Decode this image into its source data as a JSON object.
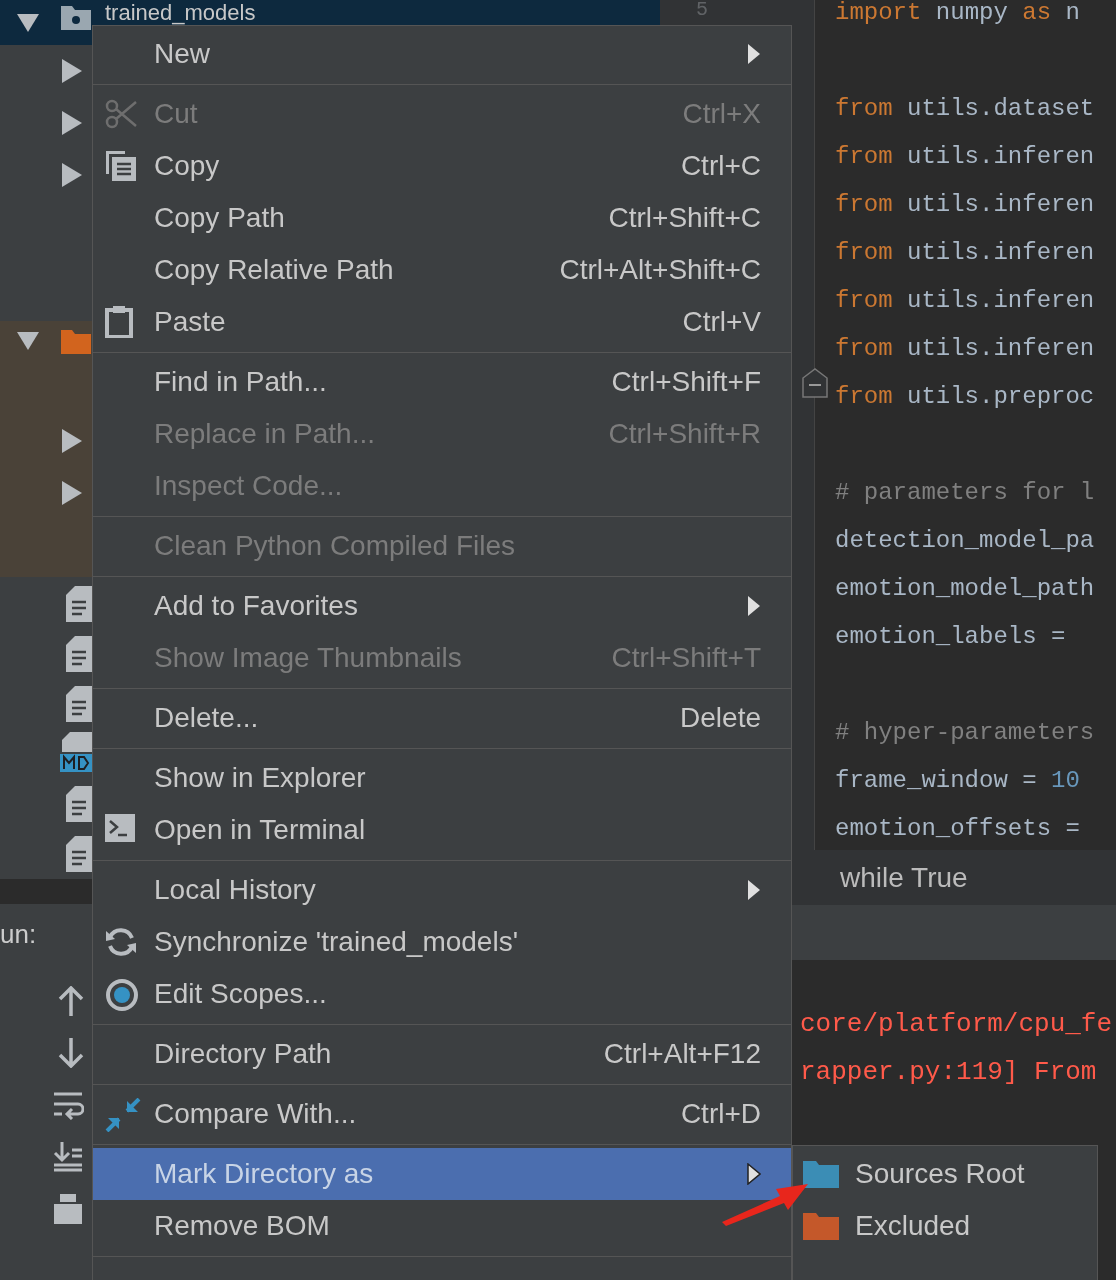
{
  "project_tree": {
    "root_label": "trained_models"
  },
  "gutter": {
    "line_number": "5"
  },
  "editor": {
    "lines": [
      {
        "kind": "code",
        "segments": [
          {
            "text": "import",
            "kind": "keyword"
          },
          {
            "text": " numpy ",
            "kind": "plain"
          },
          {
            "text": "as",
            "kind": "keyword"
          },
          {
            "text": " n",
            "kind": "plain"
          }
        ]
      },
      {
        "kind": "blank"
      },
      {
        "kind": "code",
        "segments": [
          {
            "text": "from",
            "kind": "keyword"
          },
          {
            "text": " utils.dataset",
            "kind": "plain"
          }
        ]
      },
      {
        "kind": "code",
        "segments": [
          {
            "text": "from",
            "kind": "keyword"
          },
          {
            "text": " utils.inferen",
            "kind": "plain"
          }
        ]
      },
      {
        "kind": "code",
        "segments": [
          {
            "text": "from",
            "kind": "keyword"
          },
          {
            "text": " utils.inferen",
            "kind": "plain"
          }
        ]
      },
      {
        "kind": "code",
        "segments": [
          {
            "text": "from",
            "kind": "keyword"
          },
          {
            "text": " utils.inferen",
            "kind": "plain"
          }
        ]
      },
      {
        "kind": "code",
        "segments": [
          {
            "text": "from",
            "kind": "keyword"
          },
          {
            "text": " utils.inferen",
            "kind": "plain"
          }
        ]
      },
      {
        "kind": "code",
        "segments": [
          {
            "text": "from",
            "kind": "keyword"
          },
          {
            "text": " utils.inferen",
            "kind": "plain"
          }
        ]
      },
      {
        "kind": "code",
        "segments": [
          {
            "text": "from",
            "kind": "keyword"
          },
          {
            "text": " utils.preproc",
            "kind": "plain"
          }
        ]
      },
      {
        "kind": "blank"
      },
      {
        "kind": "code",
        "segments": [
          {
            "text": "# parameters for l",
            "kind": "comment"
          }
        ]
      },
      {
        "kind": "code",
        "segments": [
          {
            "text": "detection_model_pa",
            "kind": "plain"
          }
        ]
      },
      {
        "kind": "code",
        "segments": [
          {
            "text": "emotion_model_path",
            "kind": "plain"
          }
        ]
      },
      {
        "kind": "code",
        "segments": [
          {
            "text": "emotion_labels =",
            "kind": "plain"
          }
        ]
      },
      {
        "kind": "blank"
      },
      {
        "kind": "code",
        "segments": [
          {
            "text": "# hyper-parameters",
            "kind": "comment"
          }
        ]
      },
      {
        "kind": "code",
        "segments": [
          {
            "text": "frame_window = ",
            "kind": "plain"
          },
          {
            "text": "10",
            "kind": "number"
          }
        ]
      },
      {
        "kind": "code",
        "segments": [
          {
            "text": "emotion_offsets =",
            "kind": "plain"
          }
        ]
      }
    ]
  },
  "breadcrumb": "while True",
  "run_panel": {
    "label": "un:"
  },
  "console": {
    "lines": [
      "core/platform/cpu_fe",
      "rapper.py:119] From"
    ]
  },
  "context_menu": {
    "items": [
      {
        "kind": "item",
        "label": "New",
        "disabled": false,
        "submenu": true,
        "selected": false
      },
      {
        "kind": "separator"
      },
      {
        "kind": "item",
        "label": "Cut",
        "shortcut": "Ctrl+X",
        "disabled": true,
        "submenu": false,
        "selected": false
      },
      {
        "kind": "item",
        "label": "Copy",
        "shortcut": "Ctrl+C",
        "disabled": false,
        "submenu": false,
        "selected": false
      },
      {
        "kind": "item",
        "label": "Copy Path",
        "shortcut": "Ctrl+Shift+C",
        "disabled": false,
        "submenu": false,
        "selected": false
      },
      {
        "kind": "item",
        "label": "Copy Relative Path",
        "shortcut": "Ctrl+Alt+Shift+C",
        "disabled": false,
        "submenu": false,
        "selected": false
      },
      {
        "kind": "item",
        "label": "Paste",
        "shortcut": "Ctrl+V",
        "disabled": false,
        "submenu": false,
        "selected": false
      },
      {
        "kind": "separator"
      },
      {
        "kind": "item",
        "label": "Find in Path...",
        "shortcut": "Ctrl+Shift+F",
        "disabled": false,
        "submenu": false,
        "selected": false
      },
      {
        "kind": "item",
        "label": "Replace in Path...",
        "shortcut": "Ctrl+Shift+R",
        "disabled": true,
        "submenu": false,
        "selected": false
      },
      {
        "kind": "item",
        "label": "Inspect Code...",
        "disabled": true,
        "submenu": false,
        "selected": false
      },
      {
        "kind": "separator"
      },
      {
        "kind": "item",
        "label": "Clean Python Compiled Files",
        "disabled": true,
        "submenu": false,
        "selected": false
      },
      {
        "kind": "separator"
      },
      {
        "kind": "item",
        "label": "Add to Favorites",
        "disabled": false,
        "submenu": true,
        "selected": false
      },
      {
        "kind": "item",
        "label": "Show Image Thumbnails",
        "shortcut": "Ctrl+Shift+T",
        "disabled": true,
        "submenu": false,
        "selected": false
      },
      {
        "kind": "separator"
      },
      {
        "kind": "item",
        "label": "Delete...",
        "shortcut": "Delete",
        "disabled": false,
        "submenu": false,
        "selected": false
      },
      {
        "kind": "separator"
      },
      {
        "kind": "item",
        "label": "Show in Explorer",
        "disabled": false,
        "submenu": false,
        "selected": false
      },
      {
        "kind": "item",
        "label": "Open in Terminal",
        "disabled": false,
        "submenu": false,
        "selected": false
      },
      {
        "kind": "separator"
      },
      {
        "kind": "item",
        "label": "Local History",
        "disabled": false,
        "submenu": true,
        "selected": false
      },
      {
        "kind": "item",
        "label": "Synchronize 'trained_models'",
        "disabled": false,
        "submenu": false,
        "selected": false
      },
      {
        "kind": "item",
        "label": "Edit Scopes...",
        "disabled": false,
        "submenu": false,
        "selected": false
      },
      {
        "kind": "separator"
      },
      {
        "kind": "item",
        "label": "Directory Path",
        "shortcut": "Ctrl+Alt+F12",
        "disabled": false,
        "submenu": false,
        "selected": false
      },
      {
        "kind": "separator"
      },
      {
        "kind": "item",
        "label": "Compare With...",
        "shortcut": "Ctrl+D",
        "disabled": false,
        "submenu": false,
        "selected": false
      },
      {
        "kind": "separator"
      },
      {
        "kind": "item",
        "label": "Mark Directory as",
        "disabled": false,
        "submenu": true,
        "selected": true
      },
      {
        "kind": "item",
        "label": "Remove BOM",
        "disabled": false,
        "submenu": false,
        "selected": false
      },
      {
        "kind": "separator"
      }
    ]
  },
  "submenu": {
    "items": [
      {
        "label": "Sources Root",
        "color": "#3b8db5"
      },
      {
        "label": "Excluded",
        "color": "#c4582a"
      }
    ]
  }
}
